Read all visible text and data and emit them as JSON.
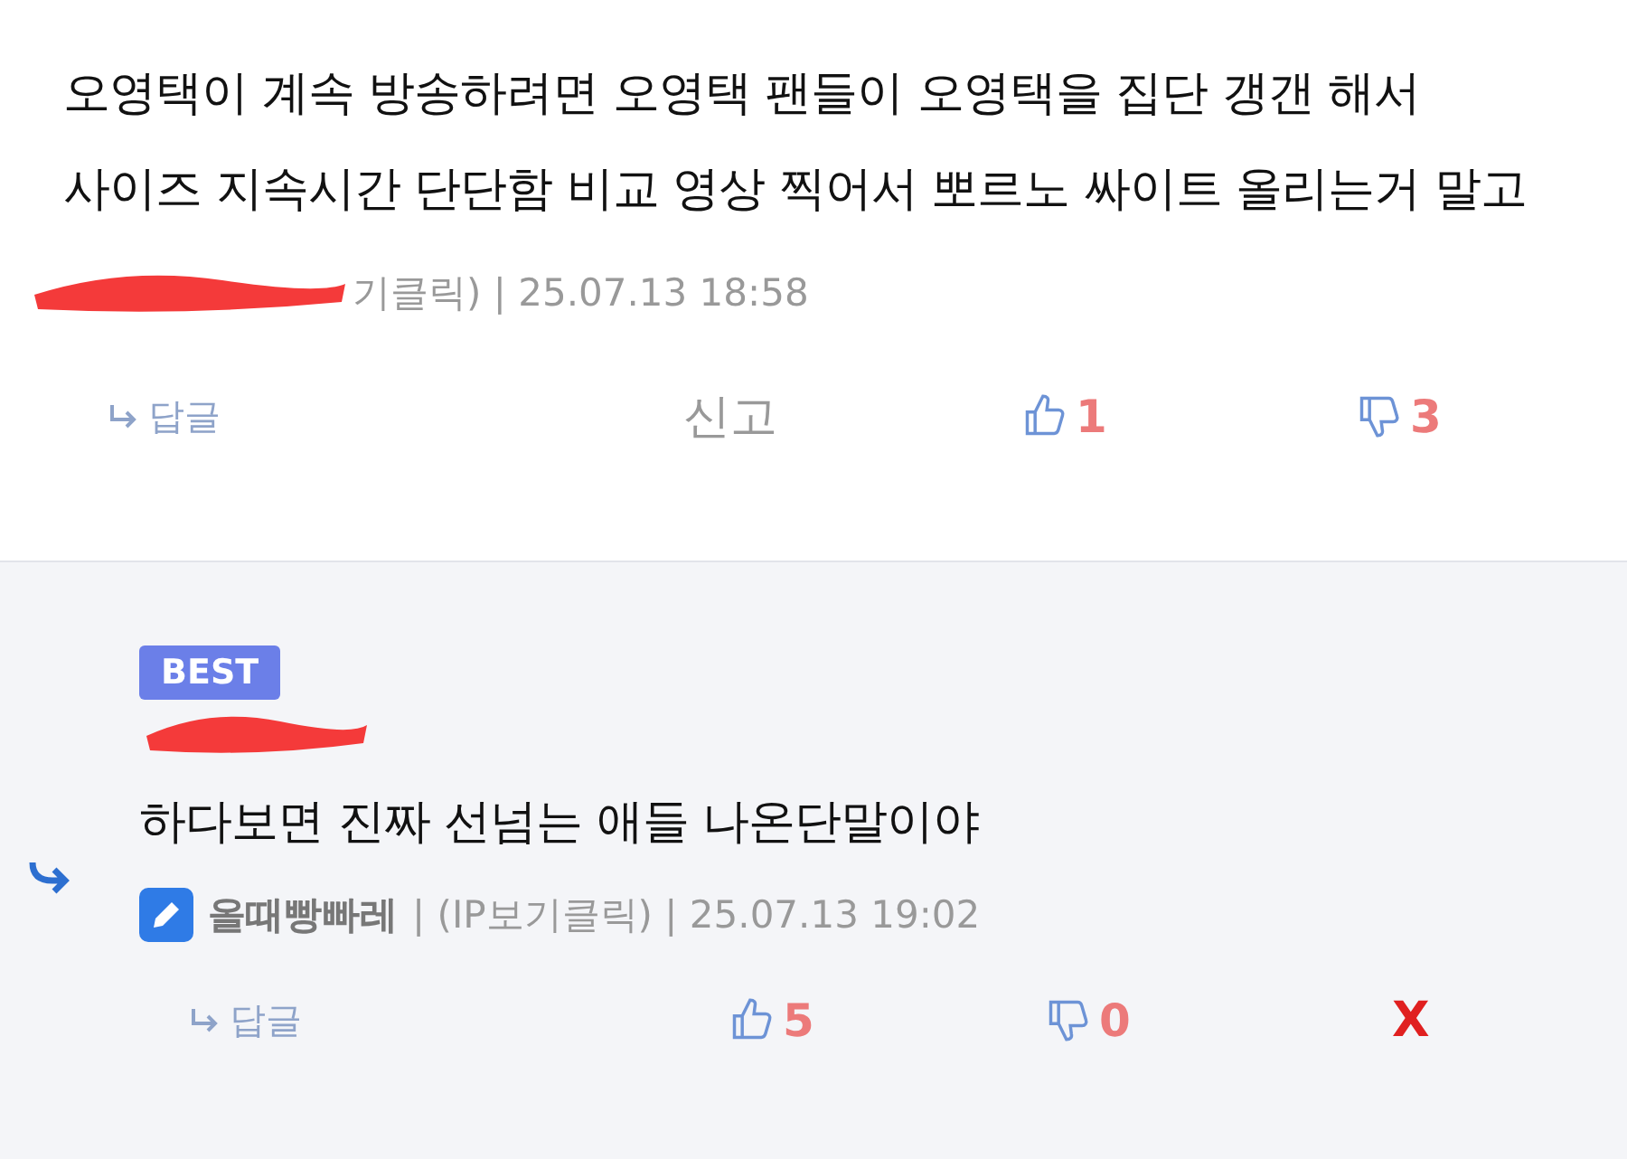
{
  "comments": [
    {
      "kind": "comment",
      "text": "오영택이 계속 방송하려면 오영택 팬들이 오영택을 집단 갱갠 해서 사이즈 지속시간 단단함 비교 영상 찍어서 뽀르노 싸이트 올리는거 말고",
      "author_redacted": true,
      "meta": "기클릭) | 25.07.13 18:58",
      "reply_label": "답글",
      "report_label": "신고",
      "likes": "1",
      "dislikes": "3"
    },
    {
      "kind": "reply",
      "badge": "BEST",
      "author_redacted": true,
      "text": "하다보면  진짜 선넘는 애들 나온단말이야",
      "author": "올때빵빠레",
      "meta": "| (IP보기클릭) | 25.07.13 19:02",
      "reply_label": "답글",
      "likes": "5",
      "dislikes": "0",
      "delete_label": "X"
    }
  ]
}
